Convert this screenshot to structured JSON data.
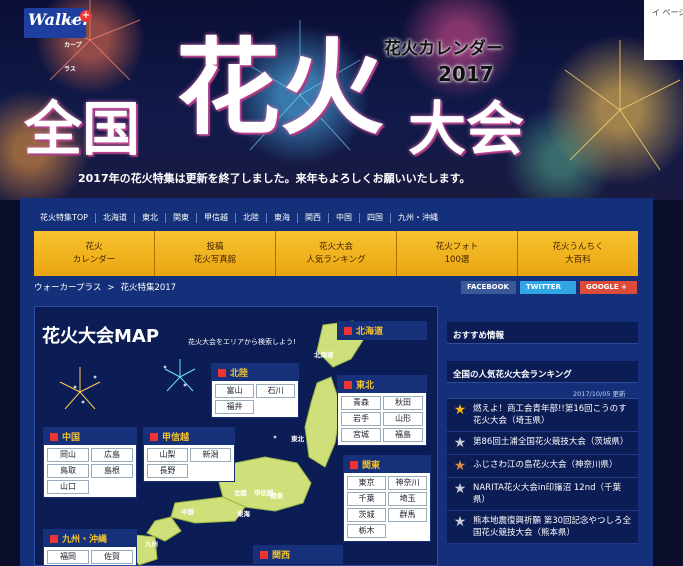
{
  "page_cut_label": "イ ページ",
  "logo": {
    "text": "Walker",
    "sub": "ウォーカープラス"
  },
  "hero": {
    "title_small": "花火カレンダー",
    "title_year": "2017",
    "title_main_1": "全国",
    "title_main_2": "花火",
    "title_main_3": "大会",
    "notice": "2017年の花火特集は更新を終了しました。来年もよろしくお願いいたします。"
  },
  "gnav": [
    "花火特集TOP",
    "北海道",
    "東北",
    "関東",
    "甲信越",
    "北陸",
    "東海",
    "関西",
    "中国",
    "四国",
    "九州・沖縄"
  ],
  "tabs": [
    {
      "l1": "花火",
      "l2": "カレンダー"
    },
    {
      "l1": "投稿",
      "l2": "花火写真館"
    },
    {
      "l1": "花火大会",
      "l2": "人気ランキング"
    },
    {
      "l1": "花火フォト",
      "l2": "100選"
    },
    {
      "l1": "花火うんちく",
      "l2": "大百科"
    }
  ],
  "breadcrumb": {
    "home": "ウォーカープラス",
    "sep": ">",
    "current": "花火特集2017"
  },
  "share": {
    "fb": "FACEBOOK",
    "tw": "TWITTER",
    "gp": "GOOGLE +"
  },
  "map": {
    "title": "花火大会MAP",
    "subtitle": "花火大会をエリアから検索しよう!",
    "regions": {
      "hokkaido": {
        "name": "北海道",
        "prefs": []
      },
      "tohoku": {
        "name": "東北",
        "prefs": [
          "青森",
          "秋田",
          "岩手",
          "山形",
          "宮城",
          "福島"
        ]
      },
      "hokuriku": {
        "name": "北陸",
        "prefs": [
          "富山",
          "石川",
          "福井"
        ]
      },
      "chugoku": {
        "name": "中国",
        "prefs": [
          "岡山",
          "広島",
          "鳥取",
          "島根",
          "山口"
        ]
      },
      "koshinetsu": {
        "name": "甲信越",
        "prefs": [
          "山梨",
          "新潟",
          "長野"
        ]
      },
      "kanto": {
        "name": "関東",
        "prefs": [
          "東京",
          "神奈川",
          "千葉",
          "埼玉",
          "茨城",
          "群馬",
          "栃木"
        ]
      },
      "kyushu": {
        "name": "九州・沖縄",
        "prefs": [
          "福岡",
          "佐賀"
        ]
      },
      "kansai": {
        "name": "関西",
        "prefs": []
      }
    },
    "pins": [
      "北海道",
      "東北",
      "関東",
      "北陸",
      "甲信越",
      "中国",
      "東海",
      "九州"
    ]
  },
  "sidebar": {
    "recommend_title": "おすすめ情報",
    "ranking_title": "全国の人気花火大会ランキング",
    "updated": "2017/10/05 更新",
    "ranking": [
      "燃えよ！商工会青年部!!第16回こうのす花火大会（埼玉県）",
      "第86回土浦全国花火競技大会（茨城県）",
      "ふじさわ江の島花火大会（神奈川県）",
      "NARITA花火大会in印旛沼 12nd（千葉県）",
      "熊本地震復興祈願 第30回記念やつしろ全国花火競技大会（熊本県）"
    ]
  },
  "colors": {
    "accent": "#f3c12c",
    "nav": "#15307a",
    "tab": "#f8c32f"
  }
}
